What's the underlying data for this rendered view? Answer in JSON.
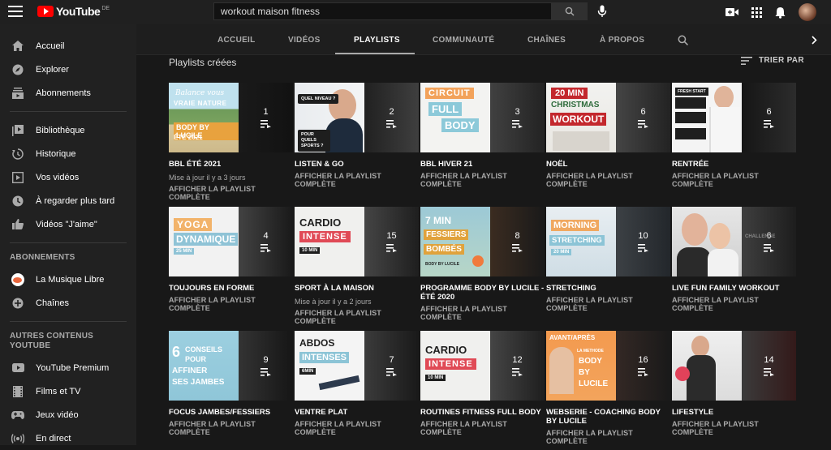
{
  "header": {
    "logo_text": "YouTube",
    "region": "DE",
    "search_value": "workout maison fitness"
  },
  "sidebar": {
    "main": [
      {
        "label": "Accueil",
        "icon": "home-icon"
      },
      {
        "label": "Explorer",
        "icon": "compass-icon"
      },
      {
        "label": "Abonnements",
        "icon": "subscriptions-icon"
      }
    ],
    "library": [
      {
        "label": "Bibliothèque",
        "icon": "library-icon"
      },
      {
        "label": "Historique",
        "icon": "history-icon"
      },
      {
        "label": "Vos vidéos",
        "icon": "your-videos-icon"
      },
      {
        "label": "À regarder plus tard",
        "icon": "clock-icon"
      },
      {
        "label": "Vidéos \"J'aime\"",
        "icon": "thumbs-up-icon"
      }
    ],
    "subs_heading": "ABONNEMENTS",
    "subs": [
      {
        "label": "La Musique Libre",
        "icon": "channel-avatar"
      },
      {
        "label": "Chaînes",
        "icon": "add-circle-icon"
      }
    ],
    "more_heading": "AUTRES CONTENUS YOUTUBE",
    "more": [
      {
        "label": "YouTube Premium",
        "icon": "youtube-icon"
      },
      {
        "label": "Films et TV",
        "icon": "film-icon"
      },
      {
        "label": "Jeux vidéo",
        "icon": "gamepad-icon"
      },
      {
        "label": "En direct",
        "icon": "live-icon"
      }
    ]
  },
  "tabs": [
    {
      "label": "ACCUEIL"
    },
    {
      "label": "VIDÉOS"
    },
    {
      "label": "PLAYLISTS",
      "active": true
    },
    {
      "label": "COMMUNAUTÉ"
    },
    {
      "label": "CHAÎNES"
    },
    {
      "label": "À PROPOS"
    }
  ],
  "section": {
    "title": "Playlists créées",
    "sort_label": "TRIER PAR"
  },
  "playlists": [
    {
      "title": "BBL ÉTÉ 2021",
      "count": "1",
      "meta": "Mise à jour il y a 3 jours",
      "link": "AFFICHER LA PLAYLIST COMPLÈTE",
      "thumb": [
        "Balance vous",
        "VRAIE NATURE",
        "BODY BY LUCILE",
        "ÉTÉ 2021"
      ]
    },
    {
      "title": "LISTEN & GO",
      "count": "2",
      "meta": "",
      "link": "AFFICHER LA PLAYLIST COMPLÈTE",
      "thumb": [
        "QUEL NIVEAU ?",
        "POUR QUELS SPORTS ?"
      ]
    },
    {
      "title": "BBL HIVER 21",
      "count": "3",
      "meta": "",
      "link": "AFFICHER LA PLAYLIST COMPLÈTE",
      "thumb": [
        "CIRCUIT",
        "FULL",
        "BODY"
      ]
    },
    {
      "title": "NOËL",
      "count": "6",
      "meta": "",
      "link": "AFFICHER LA PLAYLIST COMPLÈTE",
      "thumb": [
        "20 MIN",
        "CHRISTMAS",
        "WORKOUT"
      ]
    },
    {
      "title": "RENTRÉE",
      "count": "6",
      "meta": "",
      "link": "AFFICHER LA PLAYLIST COMPLÈTE",
      "thumb": [
        "FRESH START",
        "ORGANISATION",
        "RENTRÉE"
      ]
    },
    {
      "title": "TOUJOURS EN FORME",
      "count": "4",
      "meta": "",
      "link": "AFFICHER LA PLAYLIST COMPLÈTE",
      "thumb": [
        "YOGA",
        "DYNAMIQUE",
        "25 MIN"
      ]
    },
    {
      "title": "SPORT À LA MAISON",
      "count": "15",
      "meta": "Mise à jour il y a 2 jours",
      "link": "AFFICHER LA PLAYLIST COMPLÈTE",
      "thumb": [
        "CARDIO",
        "INTENSE",
        "10 MIN"
      ]
    },
    {
      "title": "PROGRAMME BODY BY LUCILE - ÉTÉ 2020",
      "count": "8",
      "meta": "",
      "link": "AFFICHER LA PLAYLIST COMPLÈTE",
      "thumb": [
        "7 MIN",
        "FESSIERS",
        "BOMBÉS",
        "BODY BY LUCILE"
      ]
    },
    {
      "title": "STRETCHING",
      "count": "10",
      "meta": "",
      "link": "AFFICHER LA PLAYLIST COMPLÈTE",
      "thumb": [
        "MORNING",
        "STRETCHING",
        "20 MIN"
      ]
    },
    {
      "title": "LIVE FUN FAMILY WORKOUT",
      "count": "6",
      "meta": "",
      "link": "AFFICHER LA PLAYLIST COMPLÈTE",
      "thumb": [
        "CHALLENGE"
      ]
    },
    {
      "title": "FOCUS JAMBES/FESSIERS",
      "count": "9",
      "meta": "",
      "link": "AFFICHER LA PLAYLIST COMPLÈTE",
      "thumb": [
        "6",
        "CONSEILS",
        "POUR",
        "AFFINER",
        "SES JAMBES"
      ]
    },
    {
      "title": "VENTRE PLAT",
      "count": "7",
      "meta": "",
      "link": "AFFICHER LA PLAYLIST COMPLÈTE",
      "thumb": [
        "ABDOS",
        "INTENSES",
        "6MIN"
      ]
    },
    {
      "title": "ROUTINES FITNESS FULL BODY",
      "count": "12",
      "meta": "",
      "link": "AFFICHER LA PLAYLIST COMPLÈTE",
      "thumb": [
        "CARDIO",
        "INTENSE",
        "10 MIN"
      ]
    },
    {
      "title": "WEBSERIE - COACHING BODY BY LUCILE",
      "count": "16",
      "meta": "",
      "link": "AFFICHER LA PLAYLIST COMPLÈTE",
      "thumb": [
        "AVANT/APRÈS",
        "LA METHODE",
        "BODY",
        "BY",
        "LUCILE"
      ]
    },
    {
      "title": "LIFESTYLE",
      "count": "14",
      "meta": "",
      "link": "AFFICHER LA PLAYLIST COMPLÈTE",
      "thumb": []
    }
  ]
}
